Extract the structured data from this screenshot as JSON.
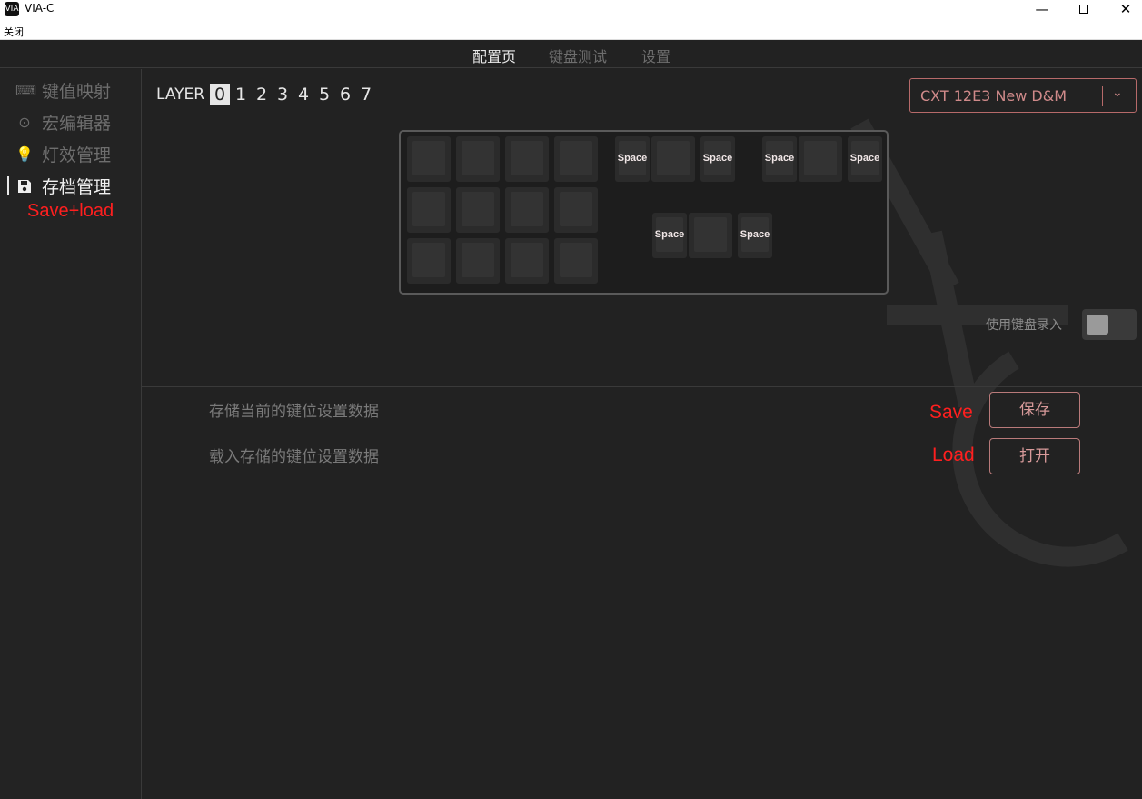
{
  "window": {
    "title": "VIA-C",
    "icon_text": "VIA",
    "menu_close": "关闭"
  },
  "tabs": [
    {
      "label": "配置页",
      "active": true
    },
    {
      "label": "键盘测试",
      "active": false
    },
    {
      "label": "设置",
      "active": false
    }
  ],
  "sidebar": {
    "items": [
      {
        "label": "键值映射",
        "icon": "keyboard-icon",
        "active": false
      },
      {
        "label": "宏编辑器",
        "icon": "record-icon",
        "active": false
      },
      {
        "label": "灯效管理",
        "icon": "lightbulb-icon",
        "active": false
      },
      {
        "label": "存档管理",
        "icon": "floppy-icon",
        "active": true
      }
    ],
    "annotation": "Save+load"
  },
  "layers": {
    "label": "LAYER",
    "numbers": [
      "0",
      "1",
      "2",
      "3",
      "4",
      "5",
      "6",
      "7"
    ],
    "active": "0"
  },
  "device": {
    "name": "CXT 12E3 New D&M"
  },
  "keyboard": {
    "space_label": "Space"
  },
  "keyboard_input": {
    "label": "使用键盘录入",
    "enabled": false
  },
  "archive": {
    "save_text": "存储当前的键位设置数据",
    "load_text": "载入存储的键位设置数据",
    "save_button": "保存",
    "open_button": "打开",
    "save_note": "Save",
    "load_note": "Load"
  },
  "colors": {
    "accent": "#d08a8a",
    "annotation": "#ff1f1f",
    "background": "#222222"
  }
}
